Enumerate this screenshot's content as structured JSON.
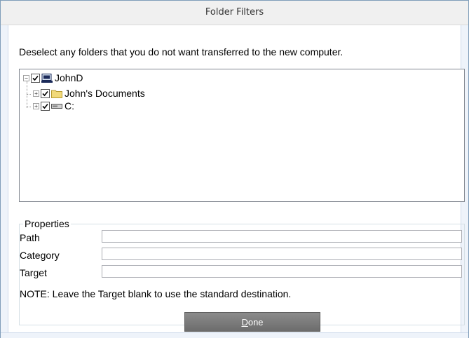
{
  "window": {
    "title": "Folder Filters"
  },
  "instruction": "Deselect any folders that you do not want transferred to the new computer.",
  "tree": {
    "root": {
      "label": "JohnD",
      "icon": "computer-icon",
      "checked": true,
      "expander": "−"
    },
    "children": [
      {
        "label": "John's Documents",
        "icon": "folder-icon",
        "checked": true,
        "expander": "+"
      },
      {
        "label": "C:",
        "icon": "drive-icon",
        "checked": true,
        "expander": "+"
      }
    ]
  },
  "properties": {
    "title": "Properties",
    "path_label": "Path",
    "path_value": "",
    "category_label": "Category",
    "category_value": "",
    "target_label": "Target",
    "target_value": "",
    "note": "NOTE: Leave the Target blank to use the standard destination."
  },
  "done_button": {
    "label_first": "D",
    "label_rest": "one"
  },
  "colors": {
    "button_bg": "#7a7a7a",
    "folder": "#f1d97a",
    "border": "#828790"
  }
}
